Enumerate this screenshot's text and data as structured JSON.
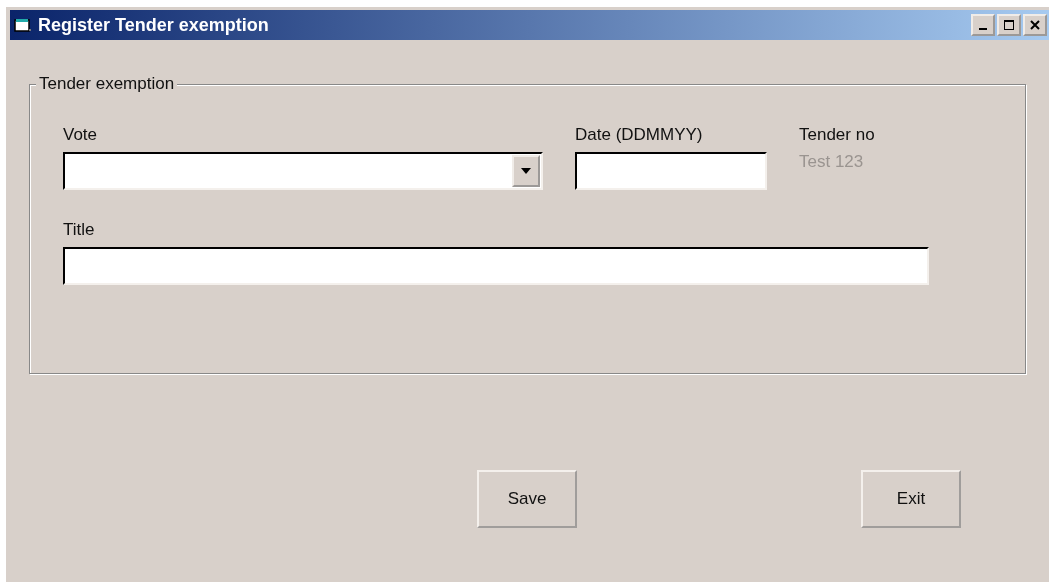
{
  "window": {
    "title": "Register Tender exemption"
  },
  "group": {
    "title": "Tender exemption"
  },
  "fields": [
    {
      "kind": "combo",
      "label": "Vote"
    },
    {
      "kind": "text",
      "label": "Date (DDMMYY)"
    },
    {
      "kind": "readonly",
      "label": "Tender no",
      "value": "Test 123",
      "disabled": true
    }
  ],
  "title_field": {
    "label": "Title"
  },
  "buttons": [
    "Save",
    "Exit"
  ]
}
